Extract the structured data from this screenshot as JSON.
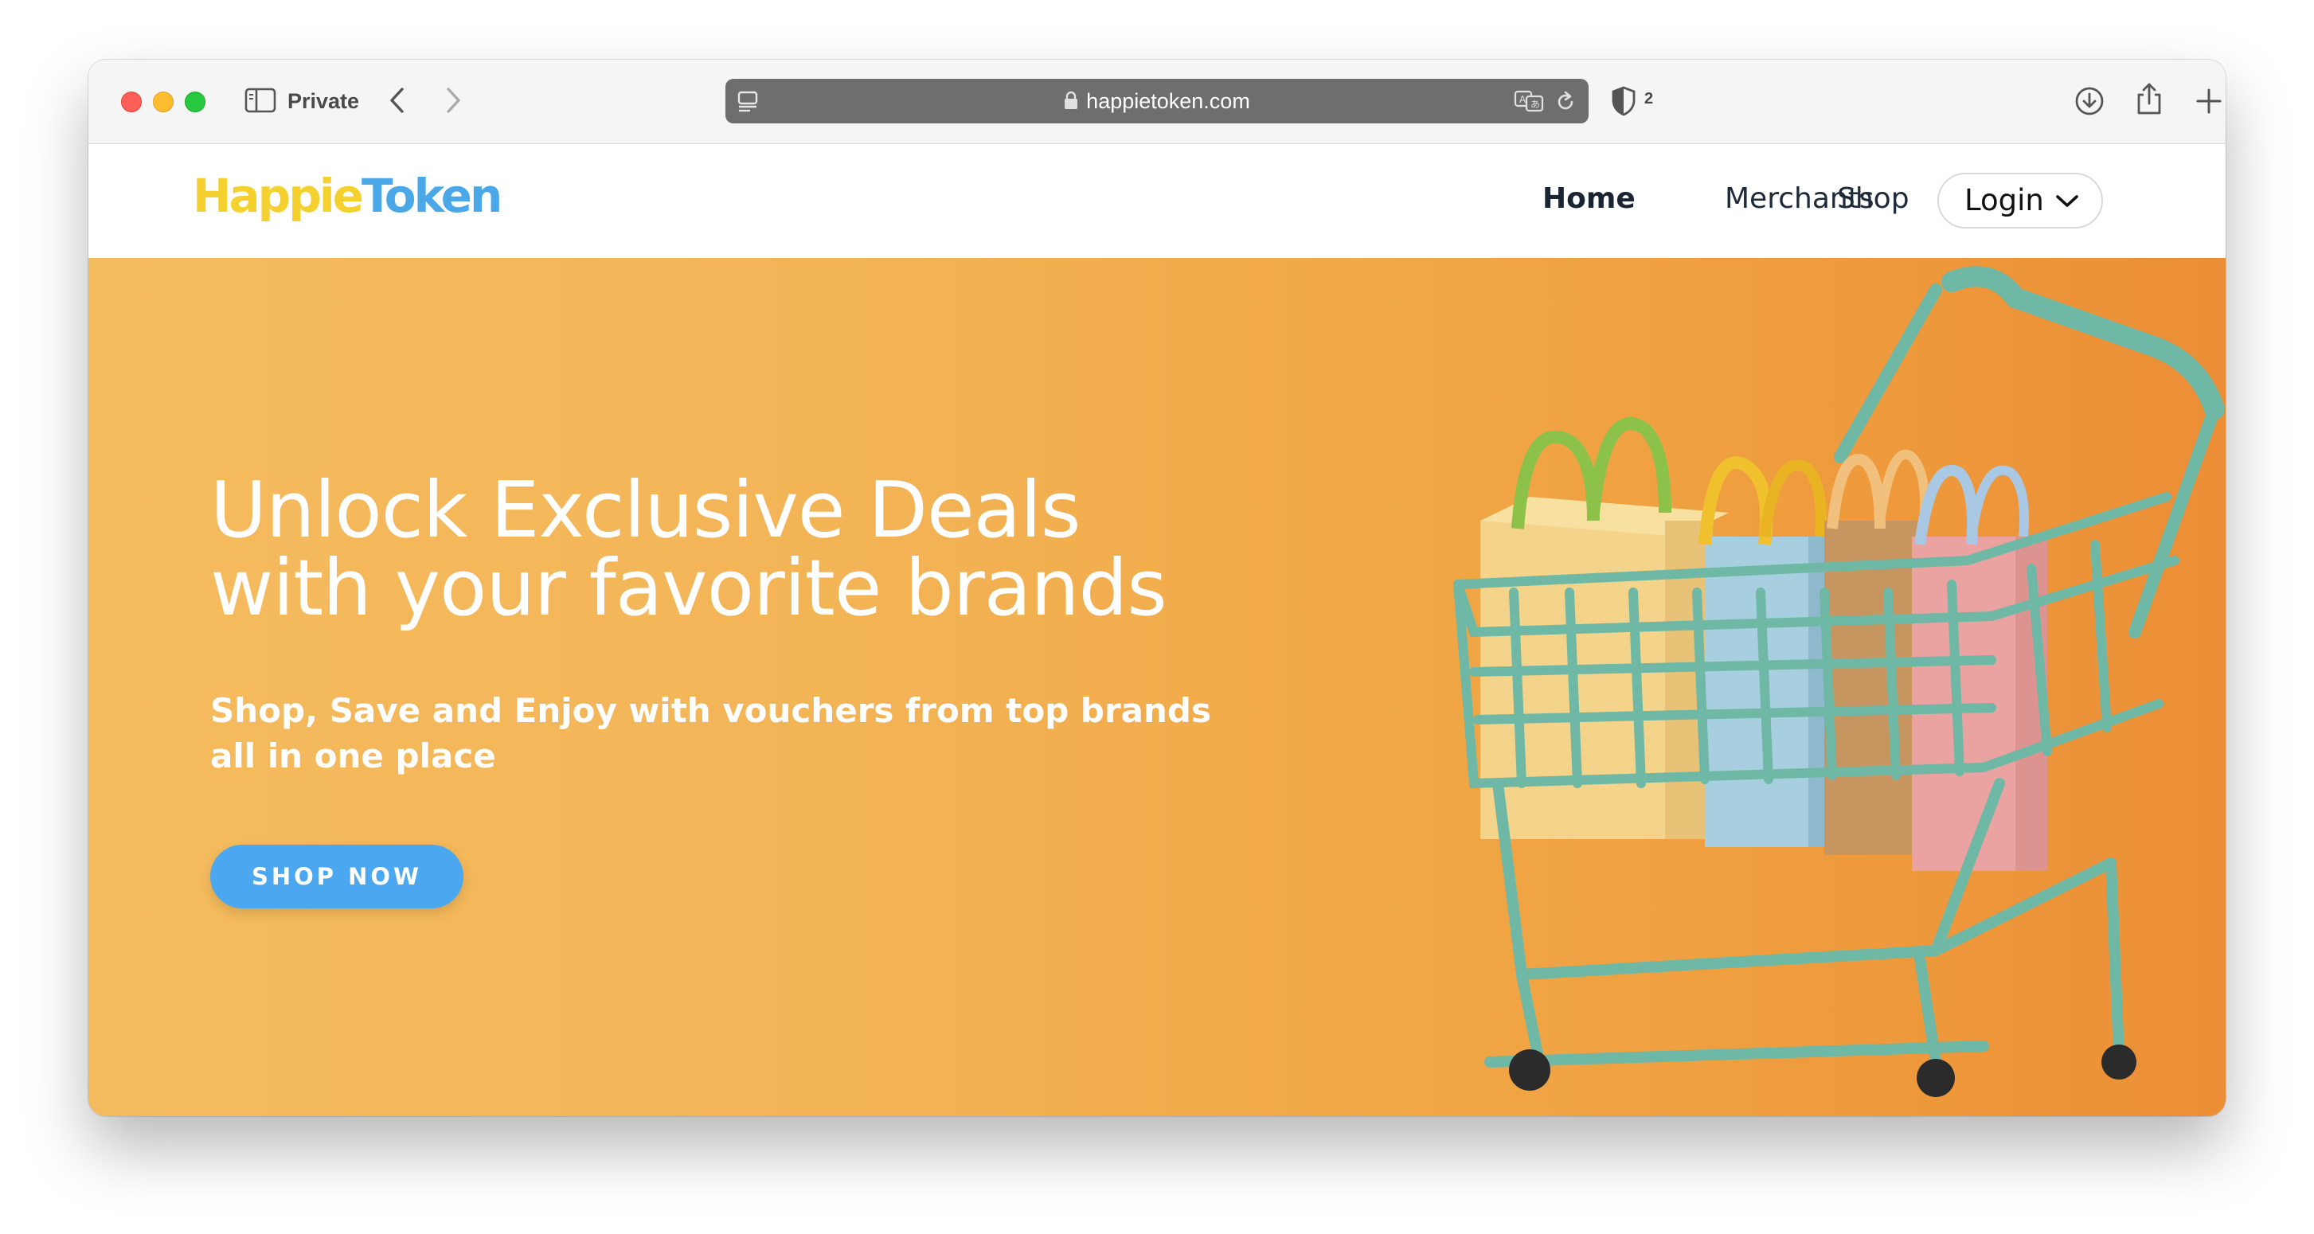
{
  "browser": {
    "private_label": "Private",
    "url": "happietoken.com",
    "shield_count": "2"
  },
  "site": {
    "logo_part1": "Happie",
    "logo_part2": "Token",
    "nav": {
      "home": "Home",
      "merchants": "Merchants",
      "shop": "Shop",
      "login": "Login"
    }
  },
  "hero": {
    "title_line1": "Unlock Exclusive Deals",
    "title_line2": "with your favorite brands",
    "subtitle": "Shop, Save and Enjoy with vouchers from top brands all in one place",
    "cta": "SHOP NOW"
  },
  "colors": {
    "hero_orange": "#f3b456",
    "cta_blue": "#4ba8f0",
    "logo_yellow": "#f5d130",
    "logo_blue": "#4aa8e8",
    "cart_teal": "#6fb8a6"
  },
  "icons": {
    "sidebar": "sidebar-icon",
    "back": "chevron-left-icon",
    "forward": "chevron-right-icon",
    "reader": "reader-icon",
    "lock": "lock-icon",
    "translate": "translate-icon",
    "reload": "reload-icon",
    "shield": "shield-icon",
    "download": "download-icon",
    "share": "share-icon",
    "new_tab": "plus-icon",
    "tabs": "tabs-overview-icon",
    "login_chevron": "chevron-down-icon"
  }
}
